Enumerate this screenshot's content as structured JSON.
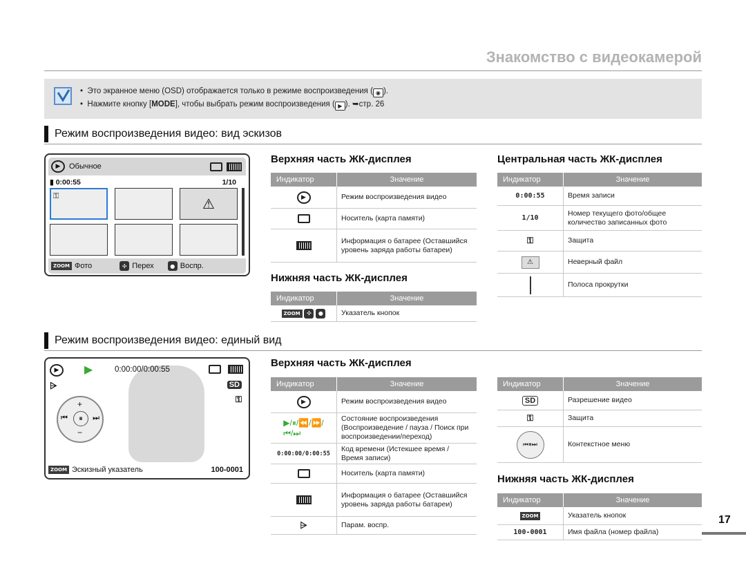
{
  "header": {
    "title": "Знакомство с видеокамерой"
  },
  "note": {
    "line1": "Это экранное меню (OSD) отображается только в режиме воспроизведения (",
    "line1_end": ").",
    "line2_a": "Нажмите кнопку [",
    "line2_mode": "MODE",
    "line2_b": "], чтобы выбрать режим воспроизведения (",
    "line2_c": "). ",
    "line2_ref": "стр. 26"
  },
  "section1": {
    "title": "Режим воспроизведения видео: вид эскизов",
    "screen": {
      "mode_label": "Обычное",
      "time": "0:00:55",
      "counter": "1/10",
      "btn_photo": "Фото",
      "btn_move": "Перех",
      "btn_play": "Воспр.",
      "zoom_label": "ZOOM"
    },
    "top": {
      "title": "Верхняя часть ЖК-дисплея",
      "col1": "Индикатор",
      "col2": "Значение",
      "rows": [
        {
          "value": "Режим воспроизведения видео"
        },
        {
          "value": "Носитель (карта памяти)"
        },
        {
          "value": "Информация о батарее (Оставшийся уровень заряда работы батареи)"
        }
      ]
    },
    "bottom": {
      "title": "Нижняя часть ЖК-дисплея",
      "col1": "Индикатор",
      "col2": "Значение",
      "rows": [
        {
          "value": "Указатель кнопок"
        }
      ]
    },
    "center": {
      "title": "Центральная часть ЖК-дисплея",
      "col1": "Индикатор",
      "col2": "Значение",
      "rows": [
        {
          "indicator": "0:00:55",
          "value": "Время записи"
        },
        {
          "indicator": "1/10",
          "value": "Номер текущего фото/общее количество записанных фото"
        },
        {
          "value": "Защита"
        },
        {
          "value": "Неверный файл"
        },
        {
          "value": "Полоса прокрутки"
        }
      ]
    }
  },
  "section2": {
    "title": "Режим воспроизведения видео: единый вид",
    "screen": {
      "time": "0:00:00/0:00:55",
      "sd": "SD",
      "thumb_label": "Эскизный указатель",
      "file": "100-0001",
      "zoom_label": "ZOOM"
    },
    "top": {
      "title": "Верхняя часть ЖК-дисплея",
      "col1": "Индикатор",
      "col2": "Значение",
      "rows": [
        {
          "value": "Режим воспроизведения видео"
        },
        {
          "value": "Состояние воспроизведения (Воспроизведение / пауза / Поиск при воспроизведении/переход)"
        },
        {
          "indicator": "0:00:00/0:00:55",
          "value": "Код времени (Истекшее время / Время записи)"
        },
        {
          "value": "Носитель (карта памяти)"
        },
        {
          "value": "Информация о батарее (Оставшийся уровень заряда работы батареи)"
        },
        {
          "value": "Парам. воспр."
        }
      ]
    },
    "right": {
      "col1": "Индикатор",
      "col2": "Значение",
      "rows": [
        {
          "indicator": "SD",
          "value": "Разрешение видео"
        },
        {
          "value": "Защита"
        },
        {
          "value": "Контекстное меню"
        }
      ]
    },
    "bottom": {
      "title": "Нижняя часть ЖК-дисплея",
      "col1": "Индикатор",
      "col2": "Значение",
      "rows": [
        {
          "indicator": "ZOOM",
          "value": "Указатель кнопок"
        },
        {
          "indicator": "100-0001",
          "value": "Имя файла (номер файла)"
        }
      ]
    }
  },
  "page_number": "17"
}
